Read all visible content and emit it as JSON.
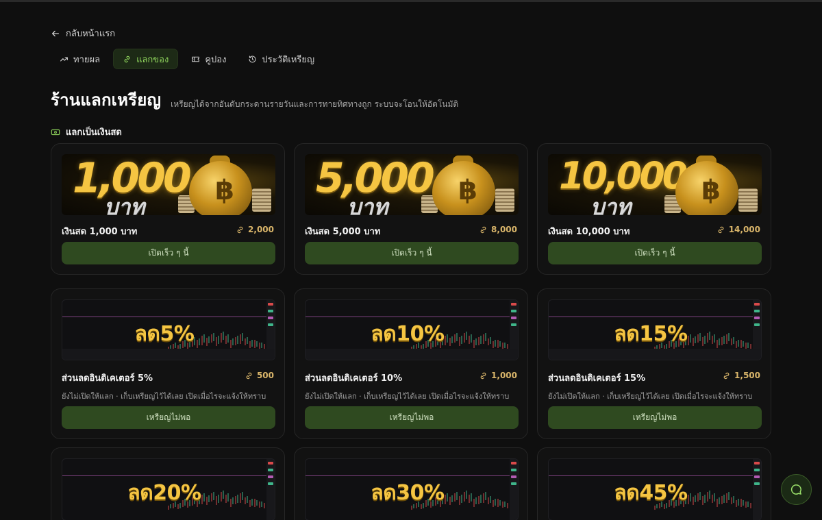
{
  "nav": {
    "back_label": "กลับหน้าแรก"
  },
  "tabs": [
    {
      "label": "ทายผล",
      "icon": "trend-icon",
      "active": false
    },
    {
      "label": "แลกของ",
      "icon": "link-icon",
      "active": true
    },
    {
      "label": "คูปอง",
      "icon": "ticket-icon",
      "active": false
    },
    {
      "label": "ประวัติเหรียญ",
      "icon": "history-icon",
      "active": false
    }
  ],
  "header": {
    "title": "ร้านแลกเหรียญ",
    "subtitle": "เหรียญได้จากอันดับกระดานรายวันและการทายทิศทางถูก ระบบจะโอนให้อัตโนมัติ"
  },
  "section": {
    "label": "แลกเป็นเงินสด",
    "icon": "cash-icon"
  },
  "cash_cards": [
    {
      "image_amount": "1,000",
      "image_unit": "บาท",
      "name": "เงินสด 1,000 บาท",
      "cost": "2,000",
      "button": "เปิดเร็ว ๆ นี้"
    },
    {
      "image_amount": "5,000",
      "image_unit": "บาท",
      "name": "เงินสด 5,000 บาท",
      "cost": "8,000",
      "button": "เปิดเร็ว ๆ นี้"
    },
    {
      "image_amount": "10,000",
      "image_unit": "บาท",
      "name": "เงินสด 10,000 บาท",
      "cost": "14,000",
      "button": "เปิดเร็ว ๆ นี้"
    }
  ],
  "indicator_cards": [
    {
      "image_text": "ลด5%",
      "name": "ส่วนลดอินดิเคเตอร์ 5%",
      "cost": "500",
      "note": "ยังไม่เปิดให้แลก · เก็บเหรียญไว้ได้เลย เปิดเมื่อไรจะแจ้งให้ทราบ",
      "button": "เหรียญไม่พอ"
    },
    {
      "image_text": "ลด10%",
      "name": "ส่วนลดอินดิเคเตอร์ 10%",
      "cost": "1,000",
      "note": "ยังไม่เปิดให้แลก · เก็บเหรียญไว้ได้เลย เปิดเมื่อไรจะแจ้งให้ทราบ",
      "button": "เหรียญไม่พอ"
    },
    {
      "image_text": "ลด15%",
      "name": "ส่วนลดอินดิเคเตอร์ 15%",
      "cost": "1,500",
      "note": "ยังไม่เปิดให้แลก · เก็บเหรียญไว้ได้เลย เปิดเมื่อไรจะแจ้งให้ทราบ",
      "button": "เหรียญไม่พอ"
    },
    {
      "image_text": "ลด20%"
    },
    {
      "image_text": "ลด30%"
    },
    {
      "image_text": "ลด45%"
    }
  ],
  "colors": {
    "accent": "#8fd45c",
    "button": "#2f4a20",
    "gold": "#f5c542",
    "coin": "#d9b56a",
    "background": "#0f0f0f"
  },
  "chat": {
    "icon": "chat-icon"
  }
}
